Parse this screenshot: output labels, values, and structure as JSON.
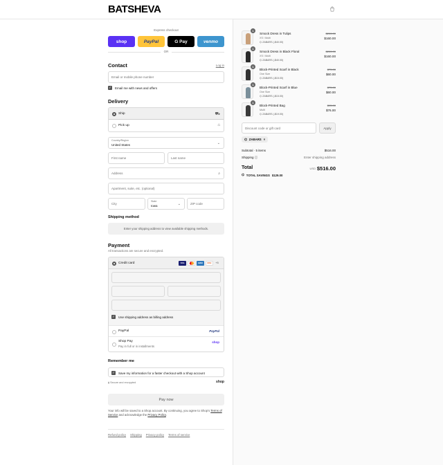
{
  "header": {
    "logo": "BATSHEVA",
    "bag_icon": "shopping-bag-icon"
  },
  "express": {
    "label": "Express checkout",
    "buttons": [
      {
        "label": "shop",
        "color": "#5a31f4"
      },
      {
        "label": "PayPal",
        "color": "#ffc439"
      },
      {
        "label": "G Pay",
        "color": "#000000"
      },
      {
        "label": "venmo",
        "color": "#3d95ce"
      }
    ],
    "or": "OR"
  },
  "contact": {
    "title": "Contact",
    "login": "Log in",
    "email_placeholder": "Email or mobile phone number",
    "news_label": "Email me with news and offers"
  },
  "delivery": {
    "title": "Delivery",
    "options": [
      {
        "label": "Ship",
        "icon": "truck-icon",
        "selected": true
      },
      {
        "label": "Pick up",
        "icon": "store-icon",
        "selected": false
      }
    ],
    "country_label": "Country/Region",
    "country_value": "United States",
    "first_name": "First name",
    "last_name": "Last name",
    "address": "Address",
    "apartment": "Apartment, suite, etc. (optional)",
    "city": "City",
    "state_label": "State",
    "state_value": "Iowa",
    "zip": "ZIP code"
  },
  "shipping_method": {
    "title": "Shipping method",
    "note": "Enter your shipping address to view available shipping methods."
  },
  "payment": {
    "title": "Payment",
    "subtitle": "All transactions are secure and encrypted.",
    "credit_card": "Credit card",
    "cards": [
      "VISA",
      "MC",
      "AMEX",
      "DISC"
    ],
    "cards_more": "+5",
    "billing_label": "Use shipping address as billing address",
    "paypal": "PayPal",
    "paypal_logo": "PayPal",
    "shoppay": "Shop Pay",
    "shoppay_sub": "Pay in full or in installments",
    "shoppay_logo": "shop"
  },
  "remember": {
    "title": "Remember me",
    "label": "Save my information for a faster checkout with a Shop account",
    "secure": "Secure and encrypted",
    "shop_logo": "shop"
  },
  "pay_button": "Pay now",
  "terms_note": {
    "part1": "Your info will be saved to a Shop account. By continuing, you agree to Shop's",
    "tos": "Terms of Service",
    "part2": "and acknowledge the",
    "privacy": "Privacy Policy",
    "end": "."
  },
  "footer_links": [
    "Refund policy",
    "Shipping",
    "Privacy policy",
    "Terms of service"
  ],
  "cart": {
    "items": [
      {
        "name": "Smock Dress in Tulips",
        "variant": "XS / Multi",
        "discount": "ZABARS (-$40.00)",
        "old_price": "$200.00",
        "price": "$160.00",
        "qty": "1",
        "color": "#c9a07a"
      },
      {
        "name": "Smock Dress in Black Floral",
        "variant": "XS / Multi",
        "discount": "ZABARS (-$40.00)",
        "old_price": "$200.00",
        "price": "$160.00",
        "qty": "1",
        "color": "#2b2b2b"
      },
      {
        "name": "Block-Printed Scarf in Black",
        "variant": "One Size",
        "discount": "ZABARS (-$15.00)",
        "old_price": "$75.00",
        "price": "$60.00",
        "qty": "1",
        "color": "#333333"
      },
      {
        "name": "Block-Printed Scarf in Blue",
        "variant": "One Size",
        "discount": "ZABARS (-$15.00)",
        "old_price": "$75.00",
        "price": "$60.00",
        "qty": "1",
        "color": "#7a8f9a"
      },
      {
        "name": "Block-Printed Bag",
        "variant": "Multi",
        "discount": "ZABARS (-$19.00)",
        "old_price": "$95.00",
        "price": "$76.00",
        "qty": "1",
        "color": "#3a3a3a"
      }
    ],
    "discount_placeholder": "Discount code or gift card",
    "apply": "Apply",
    "applied_code": "ZABARS",
    "subtotal_label": "Subtotal · 5 items",
    "subtotal_value": "$516.00",
    "shipping_label": "Shipping",
    "shipping_value": "Enter shipping address",
    "total_label": "Total",
    "currency": "USD",
    "total_value": "$516.00",
    "savings_label": "TOTAL SAVINGS",
    "savings_value": "$129.00"
  }
}
